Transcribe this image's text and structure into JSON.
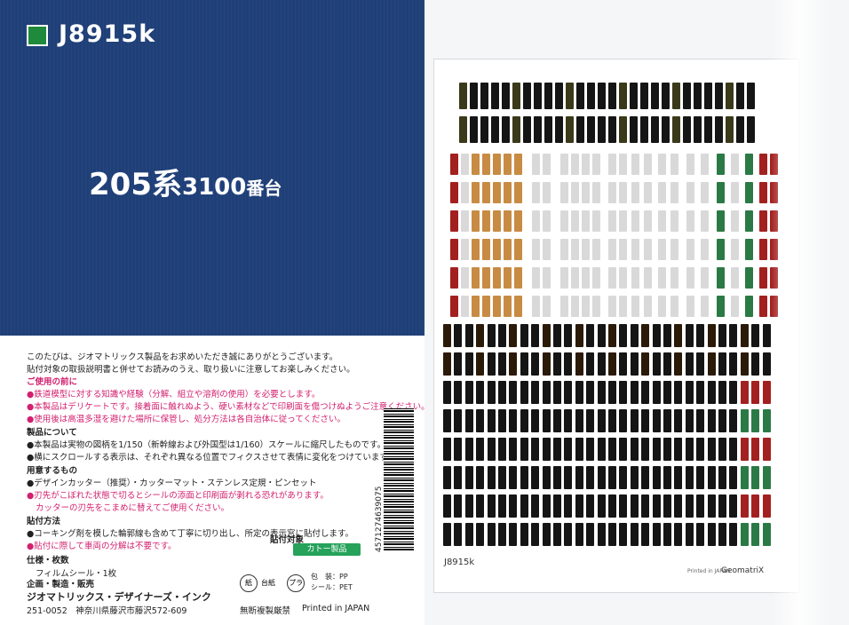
{
  "cover": {
    "code": "J8915k",
    "title_main": "205系",
    "title_num": "3100",
    "title_suffix": "番台"
  },
  "panel": {
    "intro1": "このたびは、ジオマトリックス製品をお求めいただき誠にありがとうございます。",
    "intro2": "貼付対象の取扱説明書と併せてお読みのうえ、取り扱いに注意してお楽しみください。",
    "before_use_heading": "ご使用の前に",
    "before1": "●鉄道模型に対する知識や経験（分解、組立や溶剤の使用）を必要とします。",
    "before2": "●本製品はデリケートです。接着面に触れぬよう、硬い素材などで印刷面を傷つけぬようご注意ください。",
    "before3": "●使用後は高温多湿を避けた場所に保管し、処分方法は各自治体に従ってください。",
    "product_heading": "製品について",
    "product1": "●本製品は実物の図柄を1/150（新幹線および外国型は1/160）スケールに縮尺したものです。",
    "product2": "●横にスクロールする表示は、それぞれ異なる位置でフィクスさせて表情に変化をつけています。",
    "prep_heading": "用意するもの",
    "prep1": "●デザインカッター（推奨）・カッターマット・ステンレス定規・ピンセット",
    "prep2": "●刃先がこぼれた状態で切るとシールの添面と印刷面が剥れる恐れがあります。",
    "prep3": "カッターの刃先をこまめに替えてご使用ください。",
    "method_heading": "貼付方法",
    "method1": "●コーキング剤を模した輪郭線も含めて丁寧に切り出し、所定の表示窓に貼付します。",
    "method2": "●貼付に際して車両の分解は不要です。",
    "spec_heading": "仕様・枚数",
    "spec_value": "フィルムシール・1枚",
    "target_heading": "貼付対象",
    "target_badge": "カトー製品",
    "maker_heading": "企画・製造・販売",
    "maker_name": "ジオマトリックス・デザイナーズ・インク",
    "address": "251-0052　神奈川県藤沢市藤沢572-609",
    "copyright": "無断複製厳禁",
    "printed": "Printed in JAPAN",
    "pkg_label_1": "台紙",
    "pkg_label_2": "包　装：PP",
    "pkg_label_3": "シール：PET",
    "barcode": "4571274639075"
  },
  "sheet": {
    "code": "J8915k",
    "brand": "GeomatriX",
    "brand_note": "Printed in JAPAN"
  }
}
